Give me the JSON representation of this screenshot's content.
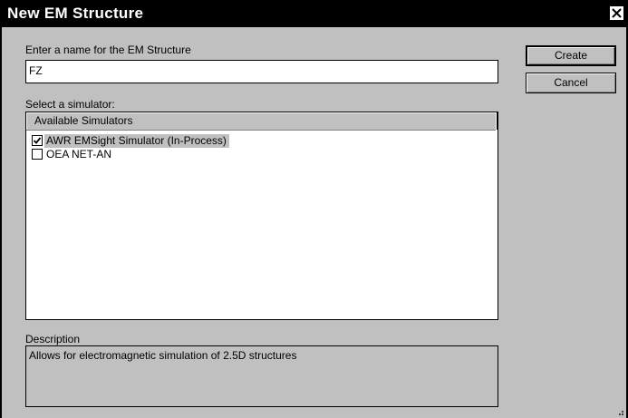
{
  "window": {
    "title": "New EM Structure"
  },
  "name_section": {
    "label": "Enter a name for the EM Structure",
    "value": "FZ"
  },
  "buttons": {
    "create_label": "Create",
    "cancel_label": "Cancel"
  },
  "simulator_section": {
    "label": "Select a simulator:",
    "column_header": "Available Simulators",
    "items": [
      {
        "label": "AWR EMSight Simulator (In-Process)",
        "checked": true,
        "selected": true
      },
      {
        "label": "OEA NET-AN",
        "checked": false,
        "selected": false
      }
    ]
  },
  "description_section": {
    "label": "Description",
    "text": "Allows for electromagnetic simulation of 2.5D structures"
  },
  "icons": {
    "close": "close-icon",
    "checkmark": "checkmark-icon",
    "resize_grip": "resize-grip-icon"
  }
}
